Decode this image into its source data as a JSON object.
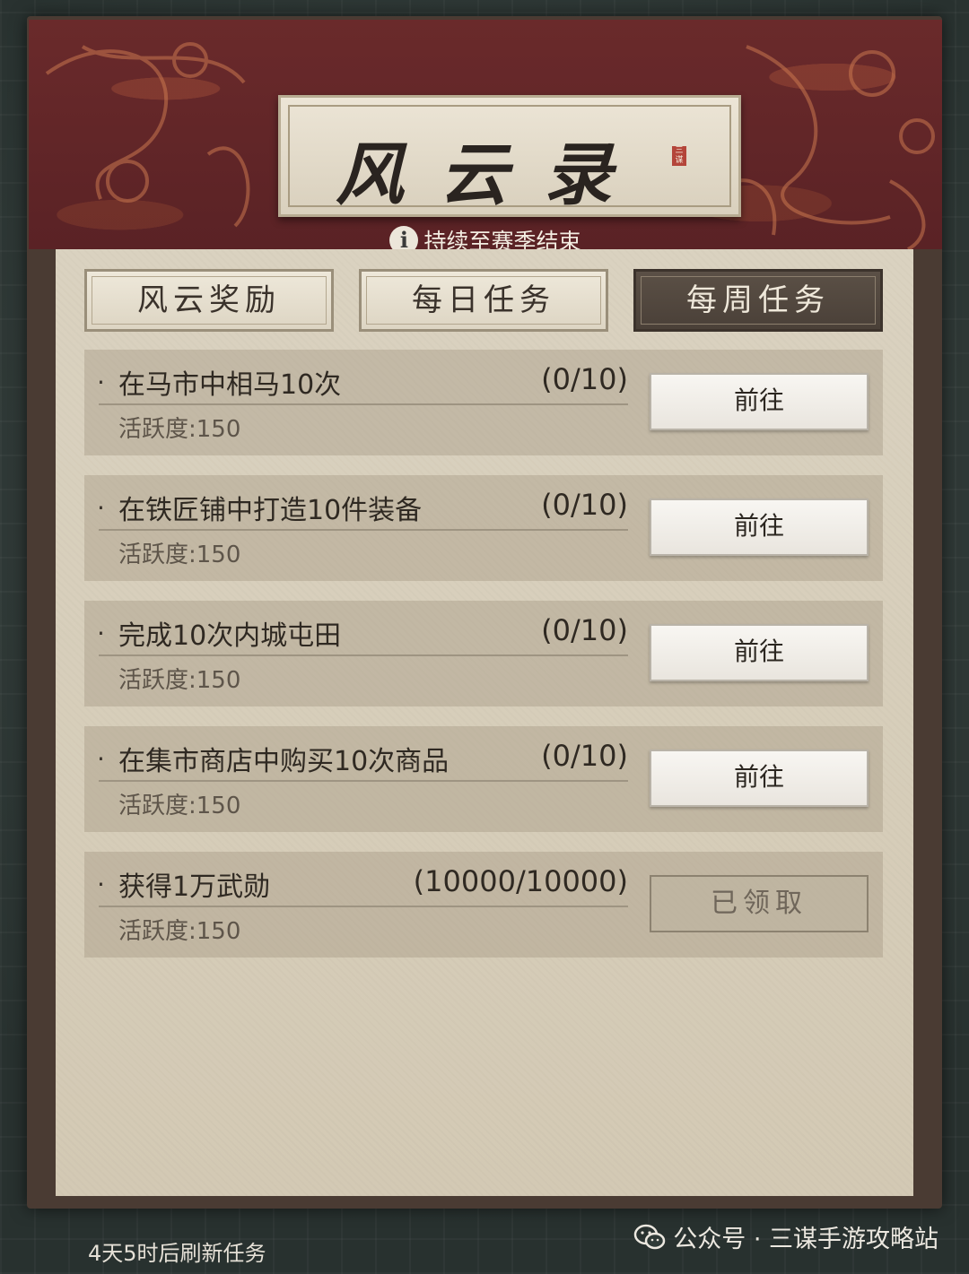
{
  "header": {
    "title": "风云录",
    "seal_text": "三谋",
    "duration": "持续至赛季结束"
  },
  "tabs": [
    {
      "label": "风云奖励",
      "active": false
    },
    {
      "label": "每日任务",
      "active": false
    },
    {
      "label": "每周任务",
      "active": true
    }
  ],
  "tasks": [
    {
      "name": "在马市中相马10次",
      "progress": "(0/10)",
      "activity": "活跃度:150",
      "button": "前往"
    },
    {
      "name": "在铁匠铺中打造10件装备",
      "progress": "(0/10)",
      "activity": "活跃度:150",
      "button": "前往"
    },
    {
      "name": "完成10次内城屯田",
      "progress": "(0/10)",
      "activity": "活跃度:150",
      "button": "前往"
    },
    {
      "name": "在集市商店中购买10次商品",
      "progress": "(0/10)",
      "activity": "活跃度:150",
      "button": "前往"
    },
    {
      "name": "获得1万武勋",
      "progress": "(10000/10000)",
      "activity": "活跃度:150",
      "button": "已领取"
    }
  ],
  "footer": {
    "refresh_text": "4天5时后刷新任务",
    "watermark": "公众号 · 三谋手游攻略站"
  },
  "colors": {
    "banner": "#5a2225",
    "parchment": "#d6cdb9",
    "active_tab": "#4a4038"
  }
}
